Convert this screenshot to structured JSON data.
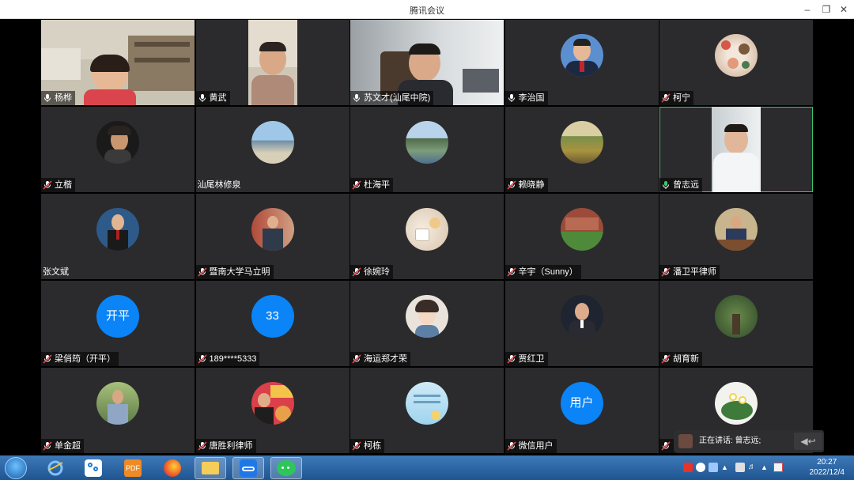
{
  "window": {
    "title": "腾讯会议"
  },
  "participants": [
    {
      "name": "杨桦",
      "kind": "video",
      "mic": "on"
    },
    {
      "name": "黄武",
      "kind": "video",
      "mic": "on"
    },
    {
      "name": "苏文才(汕尾中院)",
      "kind": "video",
      "mic": "on"
    },
    {
      "name": "李治国",
      "kind": "avatar",
      "mic": "on"
    },
    {
      "name": "柯宁",
      "kind": "avatar",
      "mic": "off"
    },
    {
      "name": "立楷",
      "kind": "avatar",
      "mic": "off"
    },
    {
      "name": "汕尾林修泉",
      "kind": "avatar",
      "mic": "none"
    },
    {
      "name": "杜海平",
      "kind": "avatar",
      "mic": "off"
    },
    {
      "name": "赖晓静",
      "kind": "avatar",
      "mic": "off"
    },
    {
      "name": "曾志远",
      "kind": "video",
      "mic": "speaking"
    },
    {
      "name": "张文斌",
      "kind": "avatar",
      "mic": "none"
    },
    {
      "name": "暨南大学马立明",
      "kind": "avatar",
      "mic": "off"
    },
    {
      "name": "徐婉玲",
      "kind": "avatar",
      "mic": "off"
    },
    {
      "name": "辛宇（Sunny）",
      "kind": "avatar",
      "mic": "off"
    },
    {
      "name": "潘卫平律师",
      "kind": "avatar",
      "mic": "off"
    },
    {
      "name": "梁俏筠（开平）",
      "kind": "text",
      "avatar_text": "开平",
      "mic": "off"
    },
    {
      "name": "189****5333",
      "kind": "text",
      "avatar_text": "33",
      "mic": "off"
    },
    {
      "name": "海运郑才荣",
      "kind": "avatar",
      "mic": "off"
    },
    {
      "name": "贾红卫",
      "kind": "avatar",
      "mic": "off"
    },
    {
      "name": "胡育新",
      "kind": "avatar",
      "mic": "off"
    },
    {
      "name": "单金超",
      "kind": "avatar",
      "mic": "off"
    },
    {
      "name": "唐胜利律师",
      "kind": "avatar",
      "mic": "off"
    },
    {
      "name": "柯栋",
      "kind": "avatar",
      "mic": "off"
    },
    {
      "name": "微信用户",
      "kind": "text",
      "avatar_text": "用户",
      "mic": "off"
    },
    {
      "name": "",
      "kind": "avatar",
      "mic": "off"
    }
  ],
  "speaking_indicator": {
    "label": "正在讲话: 曾志远;"
  },
  "taskbar": {
    "apps": [
      "windows-start",
      "internet-explorer",
      "app-blue-grid",
      "foxit-pdf",
      "firefox",
      "file-explorer",
      "tencent-meeting",
      "wechat"
    ],
    "clock_time": "20:27",
    "clock_date": "2022/12/4"
  },
  "colors": {
    "tile_bg": "#2b2b2d",
    "text_avatar_blue": "#0a84f7",
    "active_speaker": "#3ec46d",
    "muted_red": "#e0474c"
  }
}
